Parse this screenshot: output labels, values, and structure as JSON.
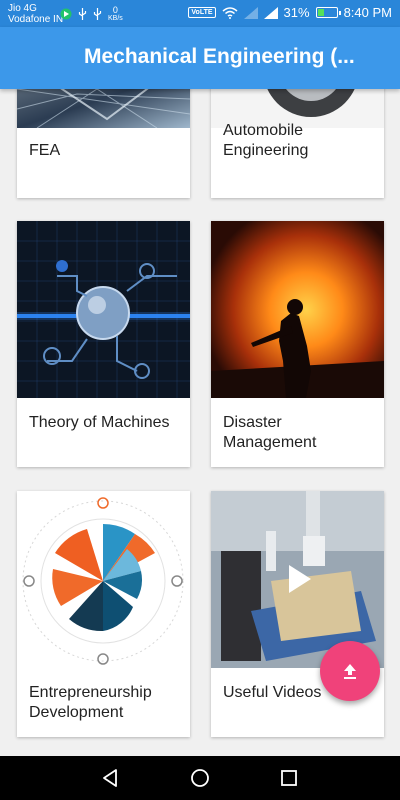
{
  "status_bar": {
    "carrier_1": "Jio 4G",
    "carrier_2": "Vodafone IN",
    "data_speed_value": "0",
    "data_speed_unit": "KB/s",
    "volte": "VoLTE",
    "battery_percent": "31%",
    "battery_level": 0.31,
    "time": "8:40 PM"
  },
  "app_bar": {
    "title": "Mechanical Engineering (..."
  },
  "cards": [
    {
      "title_line1": "FEA",
      "title_line2": "",
      "image_icon": "fea-mesh-image"
    },
    {
      "title_line1": "Automobile",
      "title_line2": "Engineering",
      "image_icon": "wheel-image"
    },
    {
      "title_line1": "Theory of Machines",
      "title_line2": "",
      "image_icon": "machine-schematic-image"
    },
    {
      "title_line1": "Disaster",
      "title_line2": "Management",
      "image_icon": "fire-firefighter-image"
    },
    {
      "title_line1": "Entrepreneurship",
      "title_line2": "Development",
      "image_icon": "radial-chart-image"
    },
    {
      "title_line1": "Useful Videos",
      "title_line2": "",
      "image_icon": "robot-video-image"
    }
  ],
  "fab": {
    "icon": "upload-icon"
  },
  "nav_bar": {
    "back_icon": "back-icon",
    "home_icon": "home-icon",
    "recents_icon": "recents-icon"
  },
  "colors": {
    "status_bar": "#2a86d9",
    "app_bar": "#3c98ea",
    "fab": "#f0427a",
    "background": "#f0f0f0"
  }
}
